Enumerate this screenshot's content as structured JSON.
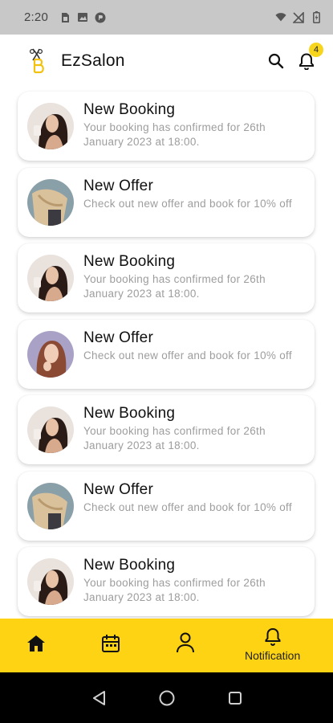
{
  "status_bar": {
    "time": "2:20",
    "icons_left": [
      "sim-card-icon",
      "image-icon",
      "app-icon"
    ],
    "icons_right": [
      "wifi-icon",
      "mobile-data-off-icon",
      "battery-icon"
    ]
  },
  "header": {
    "title": "EzSalon",
    "notification_count": "4",
    "accent_color": "#f7d51d"
  },
  "notifications": [
    {
      "title": "New Booking",
      "message": "Your booking has confirmed for 26th January 2023 at 18:00.",
      "avatar": "woman-dark-hair"
    },
    {
      "title": "New Offer",
      "message": "Check out new offer and book for 10% off",
      "avatar": "woman-blonde-back"
    },
    {
      "title": "New Booking",
      "message": "Your booking has confirmed for 26th January 2023 at 18:00.",
      "avatar": "woman-dark-hair"
    },
    {
      "title": "New Offer",
      "message": "Check out new offer and book for 10% off",
      "avatar": "woman-red-hair"
    },
    {
      "title": "New Booking",
      "message": "Your booking has confirmed for 26th January 2023 at 18:00.",
      "avatar": "woman-dark-hair"
    },
    {
      "title": "New Offer",
      "message": "Check out new offer and book for 10% off",
      "avatar": "woman-blonde-back"
    },
    {
      "title": "New Booking",
      "message": "Your booking has confirmed for 26th January 2023 at 18:00.",
      "avatar": "woman-dark-hair"
    }
  ],
  "bottom_nav": {
    "color": "#fdd313",
    "items": [
      {
        "icon": "home-icon",
        "label": ""
      },
      {
        "icon": "calendar-icon",
        "label": ""
      },
      {
        "icon": "profile-icon",
        "label": ""
      },
      {
        "icon": "bell-icon",
        "label": "Notification"
      }
    ]
  },
  "system_nav": {
    "buttons": [
      "back-icon",
      "home-circle-icon",
      "recents-icon"
    ]
  }
}
